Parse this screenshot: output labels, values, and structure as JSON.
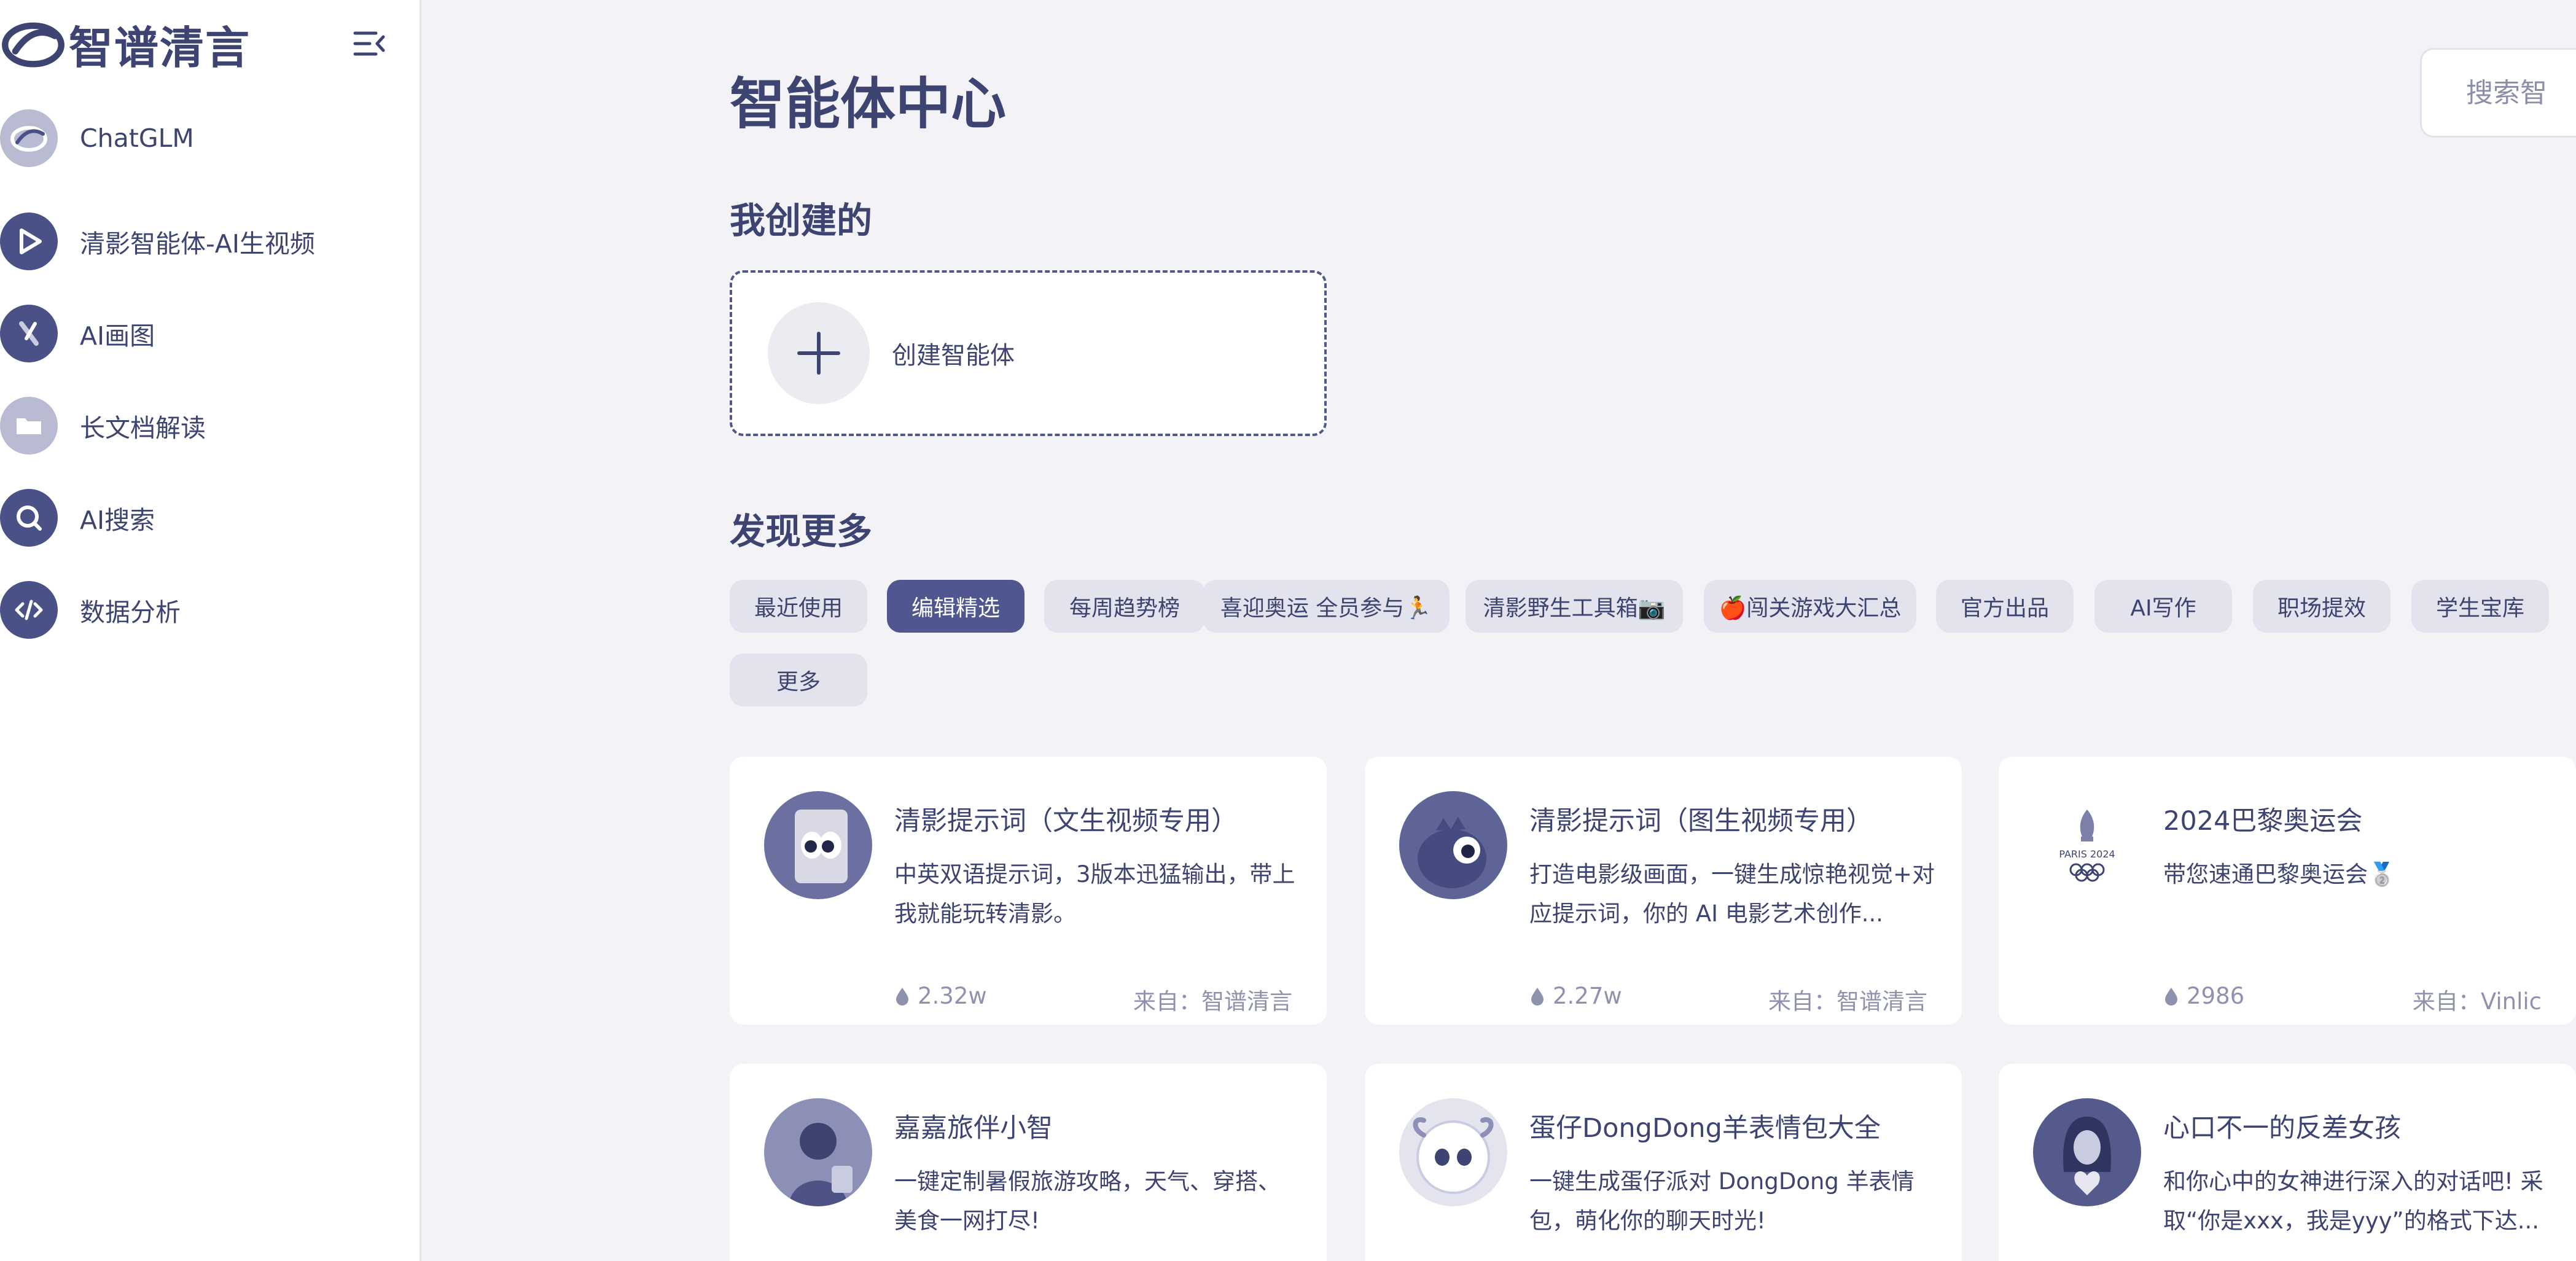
{
  "sidebar": {
    "brand": "智谱清言",
    "items": [
      {
        "label": "ChatGLM",
        "icon": "chatglm-logo-icon"
      },
      {
        "label": "清影智能体-AI生视频",
        "icon": "play-icon"
      },
      {
        "label": "AI画图",
        "icon": "brush-icon"
      },
      {
        "label": "长文档解读",
        "icon": "folder-icon"
      },
      {
        "label": "AI搜索",
        "icon": "search-icon"
      },
      {
        "label": "数据分析",
        "icon": "code-icon"
      }
    ]
  },
  "main": {
    "title": "智能体中心",
    "search_placeholder": "搜索智",
    "my_created": {
      "title": "我创建的",
      "create_label": "创建智能体"
    },
    "discover": {
      "title": "发现更多",
      "tabs": [
        {
          "label": "最近使用",
          "active": false
        },
        {
          "label": "编辑精选",
          "active": true
        },
        {
          "label": "每周趋势榜",
          "active": false
        },
        {
          "label": "喜迎奥运 全员参与🏃",
          "active": false
        },
        {
          "label": "清影野生工具箱📷",
          "active": false
        },
        {
          "label": "🍎闯关游戏大汇总",
          "active": false
        },
        {
          "label": "官方出品",
          "active": false
        },
        {
          "label": "AI写作",
          "active": false
        },
        {
          "label": "职场提效",
          "active": false
        },
        {
          "label": "学生宝库",
          "active": false
        },
        {
          "label": "更多",
          "active": false
        }
      ]
    },
    "cards": [
      {
        "title": "清影提示词（文生视频专用）",
        "desc": "中英双语提示词，3版本迅猛输出，带上我就能玩转清影。",
        "count": "2.32w",
        "source": "来自：智谱清言"
      },
      {
        "title": "清影提示词（图生视频专用）",
        "desc": "打造电影级画面，一键生成惊艳视觉+对应提示词，你的 AI 电影艺术创作...",
        "count": "2.27w",
        "source": "来自：智谱清言"
      },
      {
        "title": "2024巴黎奥运会",
        "desc": "带您速通巴黎奥运会🥈",
        "count": "2986",
        "source": "来自：Vinlic",
        "avatar_text": "PARIS 2024"
      },
      {
        "title": "嘉嘉旅伴小智",
        "desc": "一键定制暑假旅游攻略，天气、穿搭、美食一网打尽!",
        "count": "",
        "source": ""
      },
      {
        "title": "蛋仔DongDong羊表情包大全",
        "desc": "一键生成蛋仔派对 DongDong 羊表情包，萌化你的聊天时光!",
        "count": "",
        "source": ""
      },
      {
        "title": "心口不一的反差女孩",
        "desc": "和你心中的女神进行深入的对话吧! 采取“你是xxx，我是yyy”的格式下达...",
        "count": "",
        "source": ""
      }
    ]
  },
  "colors": {
    "primary": "#4f5690",
    "text": "#3d4472",
    "muted": "#8e92ad",
    "background": "#f3f3f7",
    "tab_bg": "#e3e3ed"
  }
}
